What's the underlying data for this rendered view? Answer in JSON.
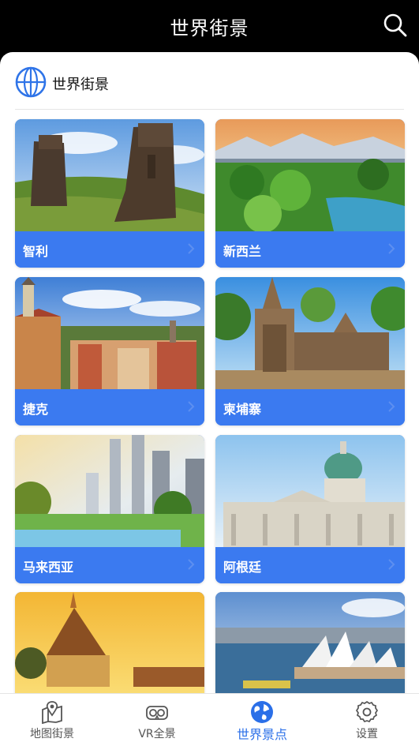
{
  "header": {
    "title": "世界街景",
    "search_icon": "search-icon"
  },
  "section": {
    "title": "世界街景",
    "icon": "globe-icon",
    "accent": "#2f74e8"
  },
  "cards": [
    {
      "name": "智利"
    },
    {
      "name": "新西兰"
    },
    {
      "name": "捷克"
    },
    {
      "name": "柬埔寨"
    },
    {
      "name": "马来西亚"
    },
    {
      "name": "阿根廷"
    },
    {
      "name": ""
    },
    {
      "name": ""
    }
  ],
  "tabbar": {
    "tabs": [
      {
        "label": "地图街景",
        "icon": "map-pin-icon"
      },
      {
        "label": "VR全景",
        "icon": "vr-goggles-icon"
      },
      {
        "label": "世界景点",
        "icon": "globe-icon",
        "active": true
      },
      {
        "label": "设置",
        "icon": "gear-icon"
      }
    ]
  },
  "colors": {
    "card_bar": "#3b7af0",
    "active_tab": "#2a6fe8",
    "top_bar": "#000000"
  }
}
